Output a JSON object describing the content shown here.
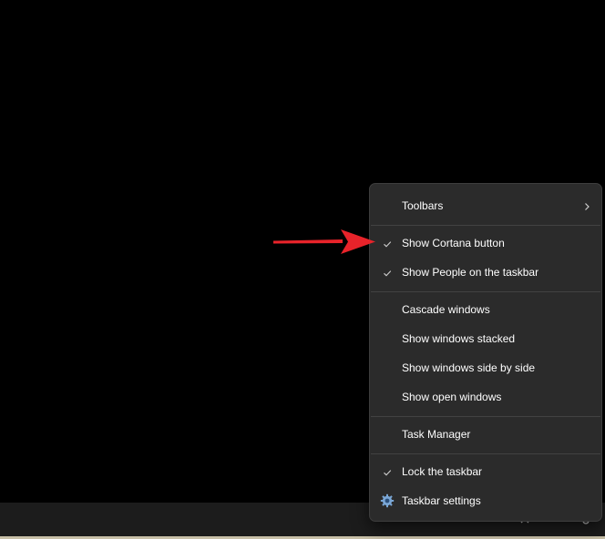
{
  "context_menu": {
    "items": [
      {
        "label": "Toolbars",
        "checked": false,
        "submenu": true
      },
      {
        "label": "Show Cortana button",
        "checked": true
      },
      {
        "label": "Show People on the taskbar",
        "checked": true
      },
      {
        "label": "Cascade windows",
        "checked": false
      },
      {
        "label": "Show windows stacked",
        "checked": false
      },
      {
        "label": "Show windows side by side",
        "checked": false
      },
      {
        "label": "Show open windows",
        "checked": false
      },
      {
        "label": "Task Manager",
        "checked": false
      },
      {
        "label": "Lock the taskbar",
        "checked": true
      },
      {
        "label": "Taskbar settings",
        "checked": false,
        "icon": "gear-icon"
      }
    ]
  },
  "colors": {
    "menu_background": "#2b2b2b",
    "menu_text": "#ffffff",
    "arrow": "#e8232a",
    "desktop": "#000000",
    "taskbar": "#1c1c1c"
  },
  "icons": {
    "check": "check-icon",
    "submenu": "chevron-right-icon",
    "settings": "gear-icon",
    "annotation": "red-arrow-icon"
  }
}
